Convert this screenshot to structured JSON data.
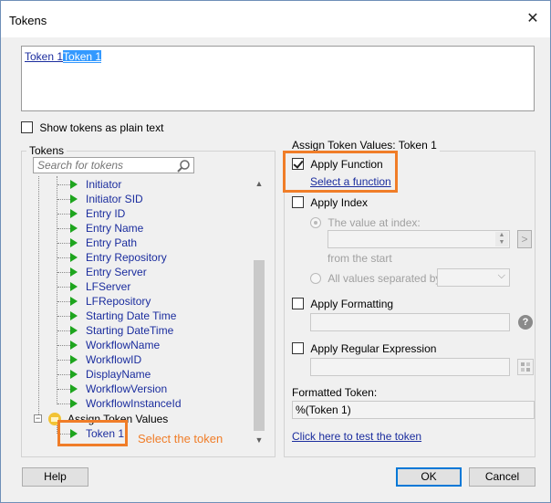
{
  "window": {
    "title": "Tokens"
  },
  "editor": {
    "token_a": "Token 1",
    "token_b": "Token 1"
  },
  "plain_text": {
    "label": "Show tokens as plain text"
  },
  "tokens_panel": {
    "label": "Tokens",
    "search_placeholder": "Search for tokens",
    "items": [
      "Initiator",
      "Initiator SID",
      "Entry ID",
      "Entry Name",
      "Entry Path",
      "Entry Repository",
      "Entry Server",
      "LFServer",
      "LFRepository",
      "Starting Date Time",
      "Starting DateTime",
      "WorkflowName",
      "WorkflowID",
      "DisplayName",
      "WorkflowVersion",
      "WorkflowInstanceId"
    ],
    "group_label": "Assign Token Values",
    "selected_item": "Token 1",
    "annotation": "Select the token"
  },
  "assign_panel": {
    "label": "Assign Token Values: Token 1",
    "apply_function": {
      "label": "Apply Function",
      "checked": true,
      "link": "Select a function"
    },
    "apply_index": {
      "label": "Apply Index",
      "radio_value": "The value at index:",
      "from_start": "from the  start",
      "radio_all": "All values separated by:",
      "go": ">"
    },
    "apply_formatting": {
      "label": "Apply Formatting",
      "help": "?"
    },
    "apply_regex": {
      "label": "Apply Regular Expression"
    },
    "formatted_label": "Formatted Token:",
    "formatted_value": "%(Token 1)",
    "test_link": "Click here to test the token"
  },
  "buttons": {
    "help": "Help",
    "ok": "OK",
    "cancel": "Cancel"
  },
  "colors": {
    "accent": "#f07d28",
    "link": "#1b2d9e",
    "selection": "#3399ff",
    "play": "#1ea51e"
  }
}
